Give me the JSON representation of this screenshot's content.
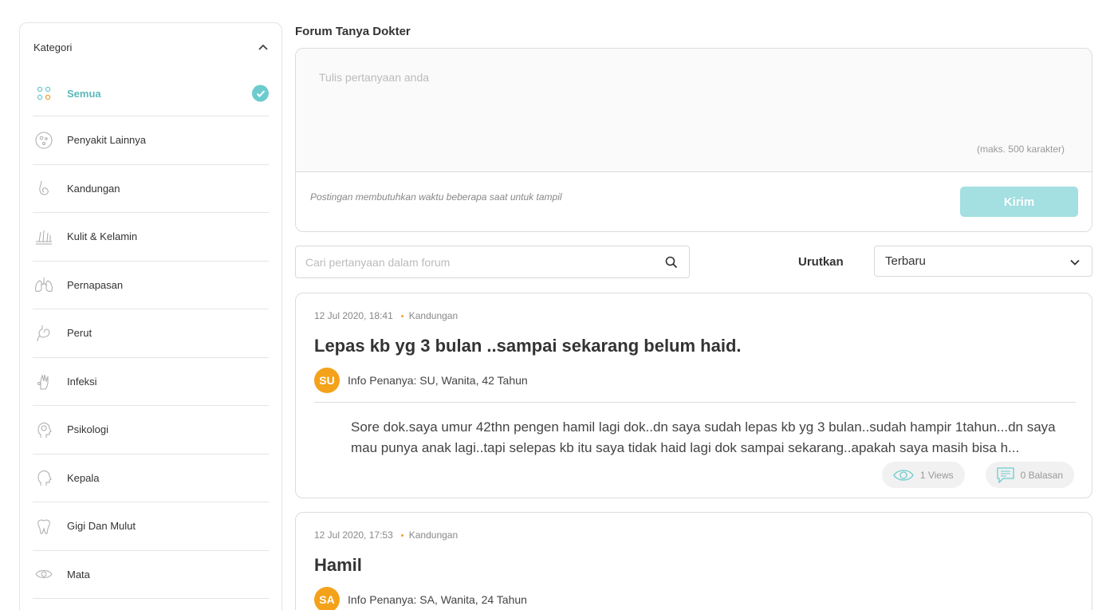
{
  "sidebar": {
    "title": "Kategori",
    "items": [
      {
        "label": "Semua",
        "icon": "grid-dots-icon",
        "active": true
      },
      {
        "label": "Penyakit Lainnya",
        "icon": "virus-icon"
      },
      {
        "label": "Kandungan",
        "icon": "pregnancy-icon"
      },
      {
        "label": "Kulit & Kelamin",
        "icon": "skin-icon"
      },
      {
        "label": "Pernapasan",
        "icon": "lungs-icon"
      },
      {
        "label": "Perut",
        "icon": "stomach-icon"
      },
      {
        "label": "Infeksi",
        "icon": "infection-icon"
      },
      {
        "label": "Psikologi",
        "icon": "brain-head-icon"
      },
      {
        "label": "Kepala",
        "icon": "head-icon"
      },
      {
        "label": "Gigi Dan Mulut",
        "icon": "tooth-icon"
      },
      {
        "label": "Mata",
        "icon": "eye-icon"
      }
    ]
  },
  "main": {
    "title": "Forum Tanya Dokter",
    "composer": {
      "placeholder": "Tulis pertanyaan anda",
      "limit": "(maks. 500 karakter)",
      "note": "Postingan membutuhkan waktu beberapa saat untuk tampil",
      "submit": "Kirim"
    },
    "search": {
      "placeholder": "Cari pertanyaan dalam forum"
    },
    "sort": {
      "label": "Urutkan",
      "value": "Terbaru"
    },
    "posts": [
      {
        "date": "12 Jul 2020, 18:41",
        "category": "Kandungan",
        "title": "Lepas kb yg 3 bulan ..sampai sekarang belum haid.",
        "initials": "SU",
        "asker": "Info Penanya: SU, Wanita, 42 Tahun",
        "body": "Sore dok.saya umur 42thn pengen hamil lagi dok..dn saya sudah lepas kb yg 3 bulan..sudah hampir 1tahun...dn saya mau punya anak lagi..tapi selepas kb itu saya tidak haid lagi dok sampai sekarang..apakah saya masih bisa h...",
        "views": "1 Views",
        "replies": "0 Balasan"
      },
      {
        "date": "12 Jul 2020, 17:53",
        "category": "Kandungan",
        "title": "Hamil",
        "initials": "SA",
        "asker": "Info Penanya: SA, Wanita, 24 Tahun"
      }
    ]
  },
  "colors": {
    "accent": "#6ccbce",
    "button": "#a4dfe1",
    "avatar": "#f3a21a",
    "meta_dot": "#f0a030"
  }
}
